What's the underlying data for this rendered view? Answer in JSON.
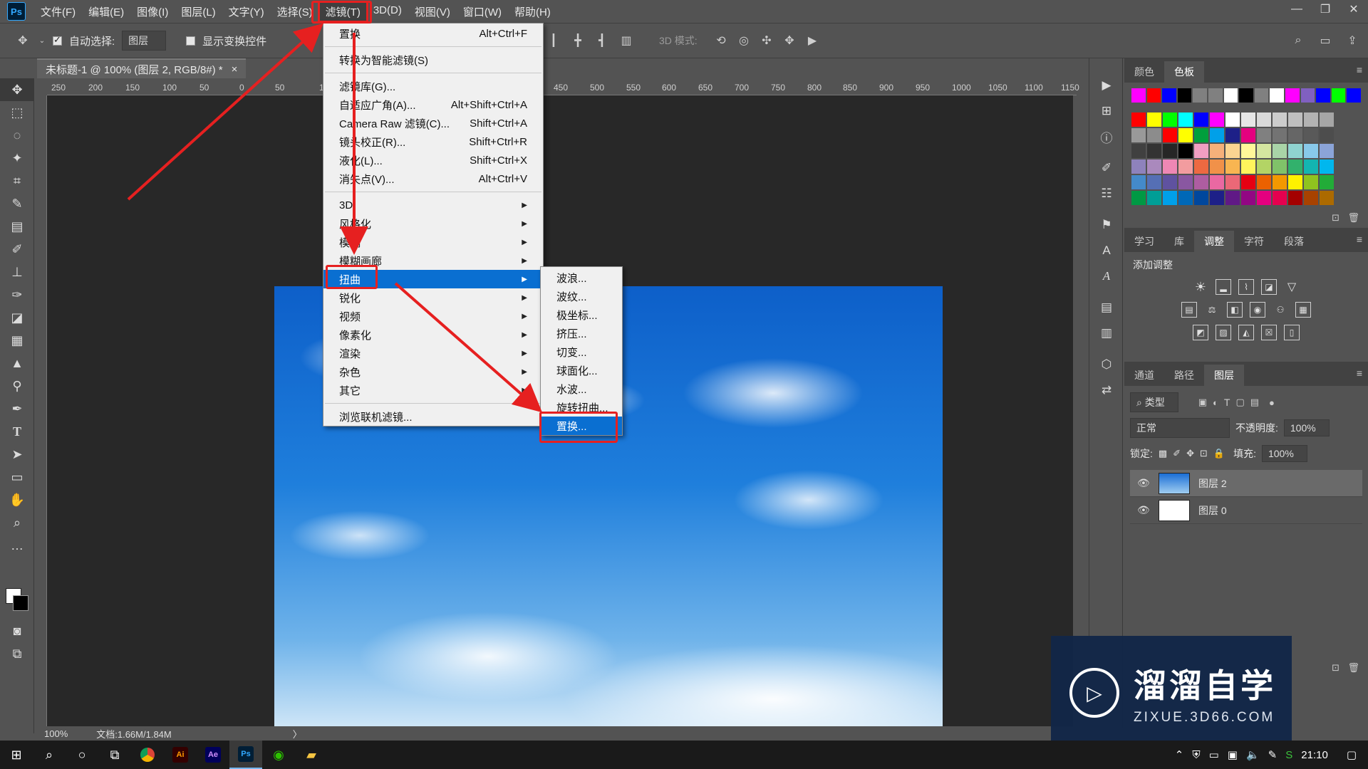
{
  "app": {
    "logo": "Ps"
  },
  "menubar": {
    "items": [
      "文件(F)",
      "编辑(E)",
      "图像(I)",
      "图层(L)",
      "文字(Y)",
      "选择(S)",
      "滤镜(T)",
      "3D(D)",
      "视图(V)",
      "窗口(W)",
      "帮助(H)"
    ],
    "active_index": 6,
    "window_controls": [
      "—",
      "❐",
      "✕"
    ]
  },
  "options": {
    "auto_select_label": "自动选择:",
    "auto_select_checked": true,
    "auto_select_target": "图层",
    "show_transform_label": "显示变换控件",
    "mode_3d_label": "3D 模式:"
  },
  "document": {
    "tab_title": "未标题-1 @ 100% (图层 2, RGB/8#) *",
    "close_symbol": "×"
  },
  "ruler": {
    "labels": [
      "250",
      "200",
      "150",
      "100",
      "50",
      "0",
      "50",
      "100",
      "450",
      "500",
      "550",
      "600",
      "650",
      "700",
      "750",
      "800",
      "850",
      "900",
      "950",
      "1000",
      "1050",
      "1100",
      "1150"
    ]
  },
  "status": {
    "zoom": "100%",
    "doc_info": "文档:1.66M/1.84M",
    "arrow": "〉"
  },
  "filter_menu": {
    "items": [
      {
        "label": "置换",
        "shortcut": "Alt+Ctrl+F"
      },
      {
        "sep": true
      },
      {
        "label": "转换为智能滤镜(S)"
      },
      {
        "sep": true
      },
      {
        "label": "滤镜库(G)..."
      },
      {
        "label": "自适应广角(A)...",
        "shortcut": "Alt+Shift+Ctrl+A"
      },
      {
        "label": "Camera Raw 滤镜(C)...",
        "shortcut": "Shift+Ctrl+A"
      },
      {
        "label": "镜头校正(R)...",
        "shortcut": "Shift+Ctrl+R"
      },
      {
        "label": "液化(L)...",
        "shortcut": "Shift+Ctrl+X"
      },
      {
        "label": "消失点(V)...",
        "shortcut": "Alt+Ctrl+V"
      },
      {
        "sep": true
      },
      {
        "label": "3D",
        "submenu": true
      },
      {
        "label": "风格化",
        "submenu": true
      },
      {
        "label": "模糊",
        "submenu": true
      },
      {
        "label": "模糊画廊",
        "submenu": true
      },
      {
        "label": "扭曲",
        "submenu": true,
        "highlighted": true
      },
      {
        "label": "锐化",
        "submenu": true
      },
      {
        "label": "视频",
        "submenu": true
      },
      {
        "label": "像素化",
        "submenu": true
      },
      {
        "label": "渲染",
        "submenu": true
      },
      {
        "label": "杂色",
        "submenu": true
      },
      {
        "label": "其它",
        "submenu": true
      },
      {
        "sep": true
      },
      {
        "label": "浏览联机滤镜..."
      }
    ]
  },
  "distort_menu": {
    "items": [
      "波浪...",
      "波纹...",
      "极坐标...",
      "挤压...",
      "切变...",
      "球面化...",
      "水波...",
      "旋转扭曲...",
      "置换..."
    ],
    "highlighted_index": 8
  },
  "swatches_panel": {
    "tabs": [
      "颜色",
      "色板"
    ],
    "active_tab": 1,
    "recent": [
      "#ff00ff",
      "#ff0000",
      "#0000ff",
      "#000000",
      "#808080",
      "#808080",
      "#ffffff",
      "#000000",
      "#808080",
      "#ffffff",
      "#ff00ff",
      "#8060c0",
      "#0000ff",
      "#00ff00",
      "#0000ff"
    ],
    "grid": [
      [
        "#ff0000",
        "#ffff00",
        "#00ff00",
        "#00ffff",
        "#0000ff",
        "#ff00ff",
        "#ffffff",
        "#e6e6e6",
        "#d9d9d9",
        "#cccccc",
        "#bfbfbf",
        "#b3b3b3",
        "#a6a6a6"
      ],
      [
        "#999999",
        "#8c8c8c",
        "#ff0000",
        "#ffff00",
        "#009f3c",
        "#00a0e9",
        "#1d2088",
        "#e4007f",
        "#808080",
        "#737373",
        "#666666",
        "#595959",
        "#4d4d4d"
      ],
      [
        "#404040",
        "#333333",
        "#262626",
        "#000000",
        "#f19ec2",
        "#f5b07a",
        "#fbd491",
        "#fff799",
        "#d5e6a0",
        "#a9d4a7",
        "#8fd3d0",
        "#88c9ea",
        "#8ba4d8"
      ],
      [
        "#8e82bc",
        "#aa89bd",
        "#ee87b4",
        "#f29c9f",
        "#ed6941",
        "#f19149",
        "#f8b551",
        "#fff45c",
        "#b3d465",
        "#80c269",
        "#32b16c",
        "#13b5b1",
        "#00b7ee"
      ],
      [
        "#448aca",
        "#556fb5",
        "#5f52a0",
        "#8957a1",
        "#ae5da1",
        "#ea68a2",
        "#eb6877",
        "#e60012",
        "#eb6100",
        "#f39800",
        "#fff100",
        "#8fc31f",
        "#22ac38"
      ],
      [
        "#009944",
        "#009e96",
        "#00a0e9",
        "#0068b7",
        "#00479d",
        "#1d2088",
        "#601986",
        "#920783",
        "#e4007f",
        "#e5004f",
        "#a40000",
        "#a84200",
        "#ac6a00"
      ]
    ]
  },
  "adjust_panel": {
    "tabs": [
      "学习",
      "库",
      "调整",
      "字符",
      "段落"
    ],
    "active_tab": 2,
    "title": "添加调整"
  },
  "layers_panel": {
    "tabs": [
      "通道",
      "路径",
      "图层"
    ],
    "active_tab": 2,
    "filter_kind": "类型",
    "blend_mode": "正常",
    "opacity_label": "不透明度:",
    "opacity_value": "100%",
    "lock_label": "锁定:",
    "fill_label": "填充:",
    "fill_value": "100%",
    "layers": [
      {
        "name": "图层 2",
        "selected": true
      },
      {
        "name": "图层 0",
        "selected": false
      }
    ]
  },
  "watermark": {
    "title": "溜溜自学",
    "subtitle": "ZIXUE.3D66.COM"
  },
  "taskbar": {
    "apps": [
      "Ai",
      "Ae",
      "Ps"
    ],
    "time": "21:10"
  }
}
